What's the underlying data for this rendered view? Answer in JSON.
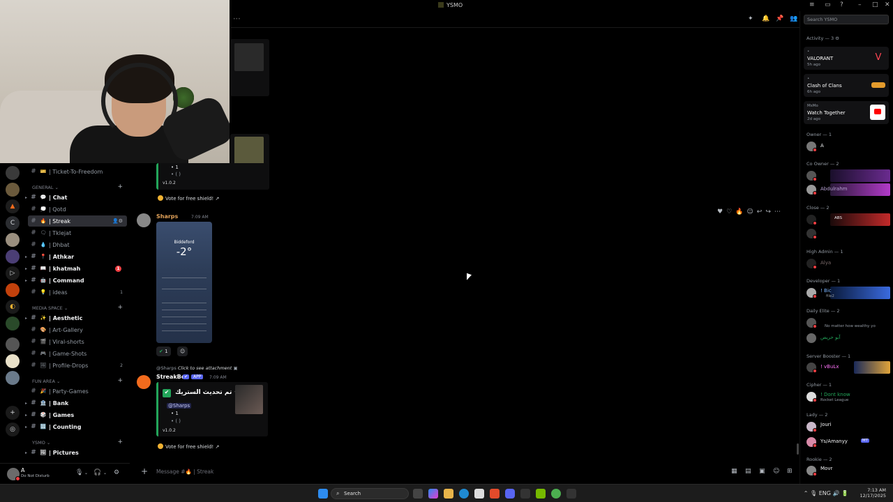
{
  "window": {
    "title": "YSMO"
  },
  "sidebar": {
    "server_initial": "C",
    "channels_top": [
      {
        "emoji": "🎫",
        "label": "| Ticket-To-Freedom",
        "bold": false
      }
    ],
    "categories": [
      {
        "label": "GENERAL",
        "channels": [
          {
            "emoji": "💬",
            "label": "| Chat",
            "bold": true
          },
          {
            "emoji": "💭",
            "label": "| Qotd",
            "bold": false
          },
          {
            "emoji": "🔥",
            "label": "| Streak",
            "bold": false,
            "active": true
          },
          {
            "emoji": "🗨",
            "label": "| Tklejat",
            "bold": false
          },
          {
            "emoji": "💧",
            "label": "| Dhbat",
            "bold": false
          },
          {
            "emoji": "📍",
            "label": "| Athkar",
            "bold": true
          },
          {
            "emoji": "📖",
            "label": "| khatmah",
            "bold": true,
            "badge": "1"
          },
          {
            "emoji": "🤖",
            "label": "| Command",
            "bold": true
          },
          {
            "emoji": "💡",
            "label": "| ideas",
            "bold": false,
            "count": "1"
          }
        ]
      },
      {
        "label": "MEDIA SPACE",
        "channels": [
          {
            "emoji": "✨",
            "label": "| Aesthetic",
            "bold": true
          },
          {
            "emoji": "🎨",
            "label": "| Art-Gallery",
            "bold": false
          },
          {
            "emoji": "🎬",
            "label": "| Viral-shorts",
            "bold": false
          },
          {
            "emoji": "🎮",
            "label": "| Game-Shots",
            "bold": false
          },
          {
            "emoji": "🖼",
            "label": "| Profile-Drops",
            "bold": false,
            "count": "2"
          }
        ]
      },
      {
        "label": "FUN AREA",
        "channels": [
          {
            "emoji": "🎉",
            "label": "| Party-Games",
            "bold": false
          },
          {
            "emoji": "🏦",
            "label": "| Bank",
            "bold": true
          },
          {
            "emoji": "🎲",
            "label": "| Games",
            "bold": true
          },
          {
            "emoji": "🔢",
            "label": "| Counting",
            "bold": true
          }
        ]
      },
      {
        "label": "YSMO",
        "channels": [
          {
            "emoji": "🖼",
            "label": "| Pictures",
            "bold": true
          }
        ]
      }
    ]
  },
  "user_panel": {
    "name": "A",
    "status": "Do Not Disturb"
  },
  "messages": {
    "top_embed": {
      "streak_line": "• 1",
      "dots_line": "• (  )",
      "version": "v1.0.2",
      "vote_label": "Vote for free shield!"
    },
    "sharps": {
      "author": "Sharps",
      "time": "7:09 AM",
      "weather_city": "Biddeford",
      "weather_temp": "-2°",
      "reaction_count": "1"
    },
    "streakbot": {
      "reply_author": "@Sharps",
      "reply_text": "Click to see attachment",
      "author": "StreakBot",
      "app_tag": "APP",
      "time": "7:09 AM",
      "title": "تم تحديث الستريك •",
      "mention": "@Sharps",
      "streak_line": "• 1",
      "dots_line": "• (  )",
      "version": "v1.0.2",
      "vote_label": "Vote for free shield!"
    }
  },
  "composer": {
    "placeholder": "Message #🔥 | Streak"
  },
  "right_panel": {
    "search_placeholder": "Search YSMO",
    "activity_header": "Activity — 3",
    "activities": [
      {
        "title": "VALORANT",
        "sub": "5h ago",
        "color": "#ff4655"
      },
      {
        "title": "Clash of Clans",
        "sub": "6h ago",
        "color": "#e39b2c"
      },
      {
        "title": "Watch Together",
        "sub": "2d ago",
        "color": "#ff0000",
        "host": "MsMo"
      }
    ],
    "roles": [
      {
        "label": "Owner — 1",
        "members": [
          {
            "name": "A"
          }
        ]
      },
      {
        "label": "Co Owner — 2",
        "members": [
          {
            "name": ""
          },
          {
            "name": "Abdulrahm"
          }
        ]
      },
      {
        "label": "Close — 2",
        "members": [
          {
            "name": "ABS"
          },
          {
            "name": ""
          }
        ]
      },
      {
        "label": "High Admin — 1",
        "members": [
          {
            "name": "Alya"
          }
        ]
      },
      {
        "label": "Developer — 1",
        "members": [
          {
            "name": "! Bic",
            "sub": "file2"
          }
        ]
      },
      {
        "label": "Daily Elite — 2",
        "members": [
          {
            "name": "",
            "sub": "No matter how wealthy yo"
          },
          {
            "name": "آبو حریص"
          }
        ]
      },
      {
        "label": "Server Booster — 1",
        "members": [
          {
            "name": "! vBuLx"
          }
        ]
      },
      {
        "label": "Cipher — 1",
        "members": [
          {
            "name": "! Dont know",
            "sub": "Rocket League"
          }
        ]
      },
      {
        "label": "Lady — 2",
        "members": [
          {
            "name": "Jouri"
          },
          {
            "name": "Ys/Amanyy",
            "tag": "MT"
          }
        ]
      },
      {
        "label": "Rookie — 2",
        "members": [
          {
            "name": "Movr"
          }
        ]
      }
    ]
  },
  "taskbar": {
    "search_label": "Search",
    "time": "7:13 AM",
    "date": "12/17/2025"
  }
}
